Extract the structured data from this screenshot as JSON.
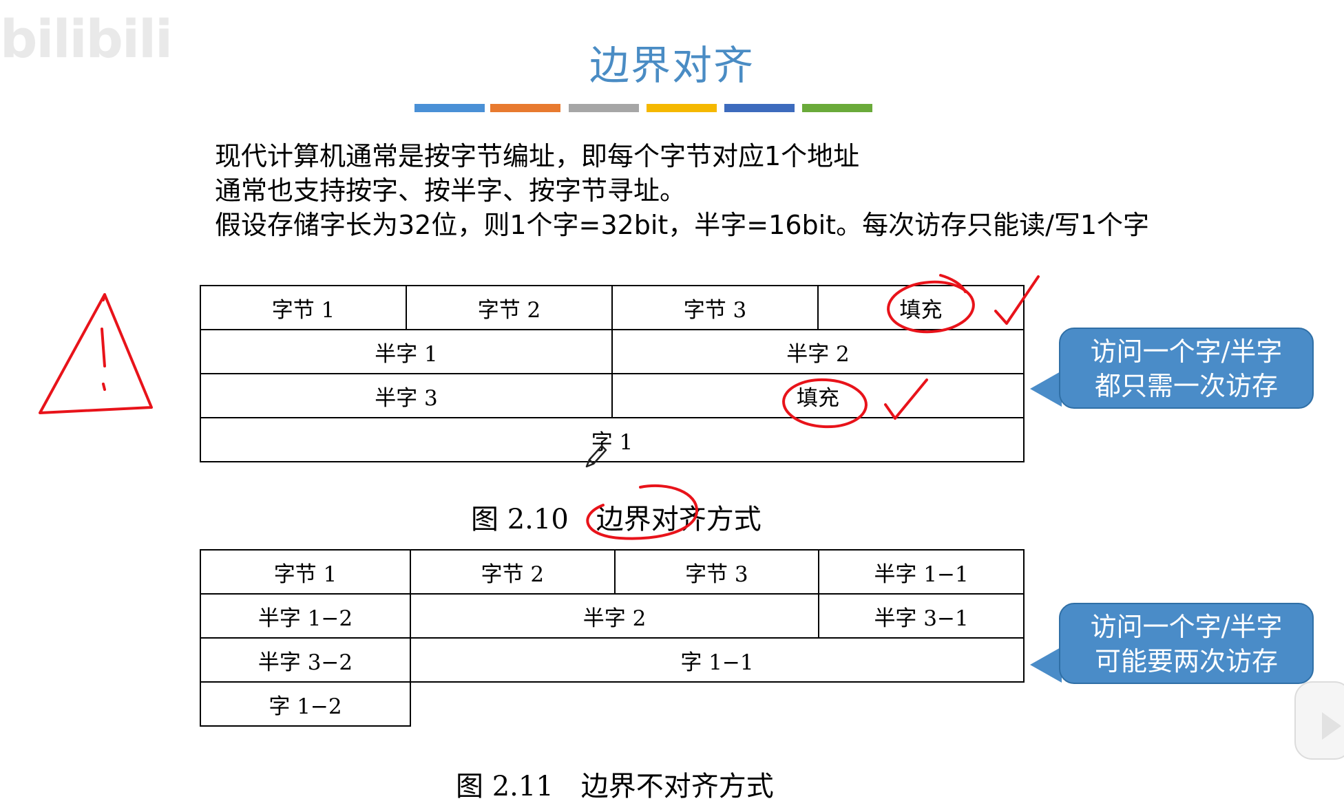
{
  "watermark": "bilibili",
  "title": "边界对齐",
  "colorbar": [
    "#4a90d6",
    "#e87a2f",
    "#a6a6a6",
    "#f5b800",
    "#3d6bbd",
    "#6aaa3a"
  ],
  "paragraph": [
    "现代计算机通常是按字节编址，即每个字节对应1个地址",
    "通常也支持按字、按半字、按字节寻址。",
    "假设存储字长为32位，则1个字=32bit，半字=16bit。每次访存只能读/写1个字"
  ],
  "figure1": {
    "row1": [
      "字节 1",
      "字节 2",
      "字节 3",
      "填充"
    ],
    "row2": [
      "半字 1",
      "半字 2"
    ],
    "row3": [
      "半字 3",
      "填充"
    ],
    "row4": [
      "字 1"
    ],
    "caption": "图 2.10　边界对齐方式"
  },
  "figure2": {
    "row1": [
      "字节 1",
      "字节 2",
      "字节 3",
      "半字 1−1"
    ],
    "row2": [
      "半字 1−2",
      "半字 2",
      "半字 3−1"
    ],
    "row3": [
      "半字 3−2",
      "字 1−1"
    ],
    "row4": [
      "字 1−2"
    ],
    "caption": "图 2.11　边界不对齐方式"
  },
  "callout1": {
    "line1": "访问一个字/半字",
    "line2": "都只需一次访存"
  },
  "callout2": {
    "line1": "访问一个字/半字",
    "line2": "可能要两次访存"
  },
  "annotation_color": "#e8131a",
  "accent_color": "#4a8cc4"
}
